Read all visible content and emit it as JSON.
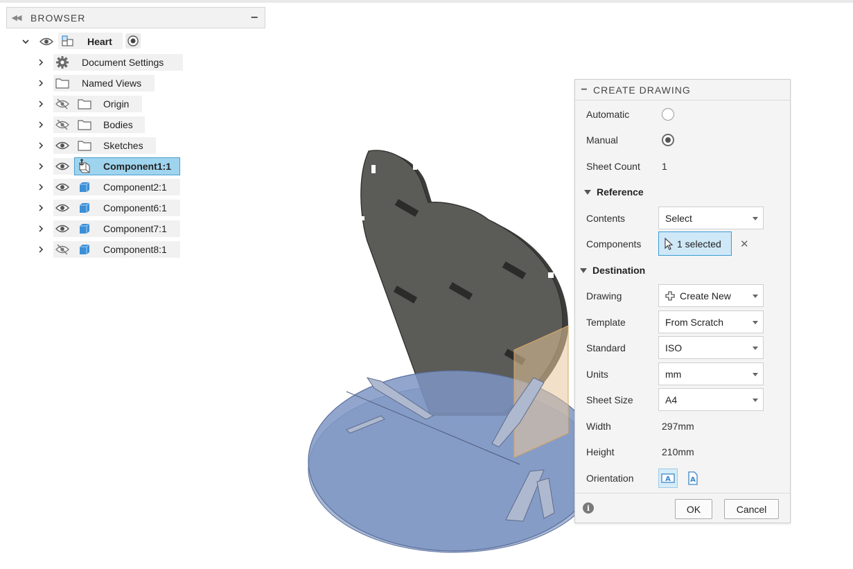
{
  "browser": {
    "title": "BROWSER",
    "root": {
      "label": "Heart"
    },
    "items": [
      {
        "label": "Document Settings",
        "icon": "gear-icon",
        "visible": null
      },
      {
        "label": "Named Views",
        "icon": "folder-icon",
        "visible": null
      },
      {
        "label": "Origin",
        "icon": "folder-icon",
        "visible": false
      },
      {
        "label": "Bodies",
        "icon": "folder-icon",
        "visible": false
      },
      {
        "label": "Sketches",
        "icon": "folder-icon",
        "visible": true
      },
      {
        "label": "Component1:1",
        "icon": "component-anchor-icon",
        "visible": true,
        "selected": true
      },
      {
        "label": "Component2:1",
        "icon": "component-icon",
        "visible": true
      },
      {
        "label": "Component6:1",
        "icon": "component-icon",
        "visible": true
      },
      {
        "label": "Component7:1",
        "icon": "component-icon",
        "visible": true
      },
      {
        "label": "Component8:1",
        "icon": "component-icon",
        "visible": false
      }
    ]
  },
  "dialog": {
    "title": "CREATE DRAWING",
    "automatic_label": "Automatic",
    "manual_label": "Manual",
    "mode_selected": "Manual",
    "sheet_count_label": "Sheet Count",
    "sheet_count_value": "1",
    "reference_section": "Reference",
    "contents_label": "Contents",
    "contents_value": "Select",
    "components_label": "Components",
    "components_value": "1 selected",
    "destination_section": "Destination",
    "drawing_label": "Drawing",
    "drawing_value": "Create New",
    "template_label": "Template",
    "template_value": "From Scratch",
    "standard_label": "Standard",
    "standard_value": "ISO",
    "units_label": "Units",
    "units_value": "mm",
    "sheet_size_label": "Sheet Size",
    "sheet_size_value": "A4",
    "width_label": "Width",
    "width_value": "297mm",
    "height_label": "Height",
    "height_value": "210mm",
    "orientation_label": "Orientation",
    "orientation_selected": "landscape",
    "ok_label": "OK",
    "cancel_label": "Cancel"
  },
  "colors": {
    "selection_blue": "#9fd4ef",
    "component_blue": "#3c8fd6",
    "heart_gray": "#5b5b58",
    "base_blue": "#8ea3c6"
  }
}
